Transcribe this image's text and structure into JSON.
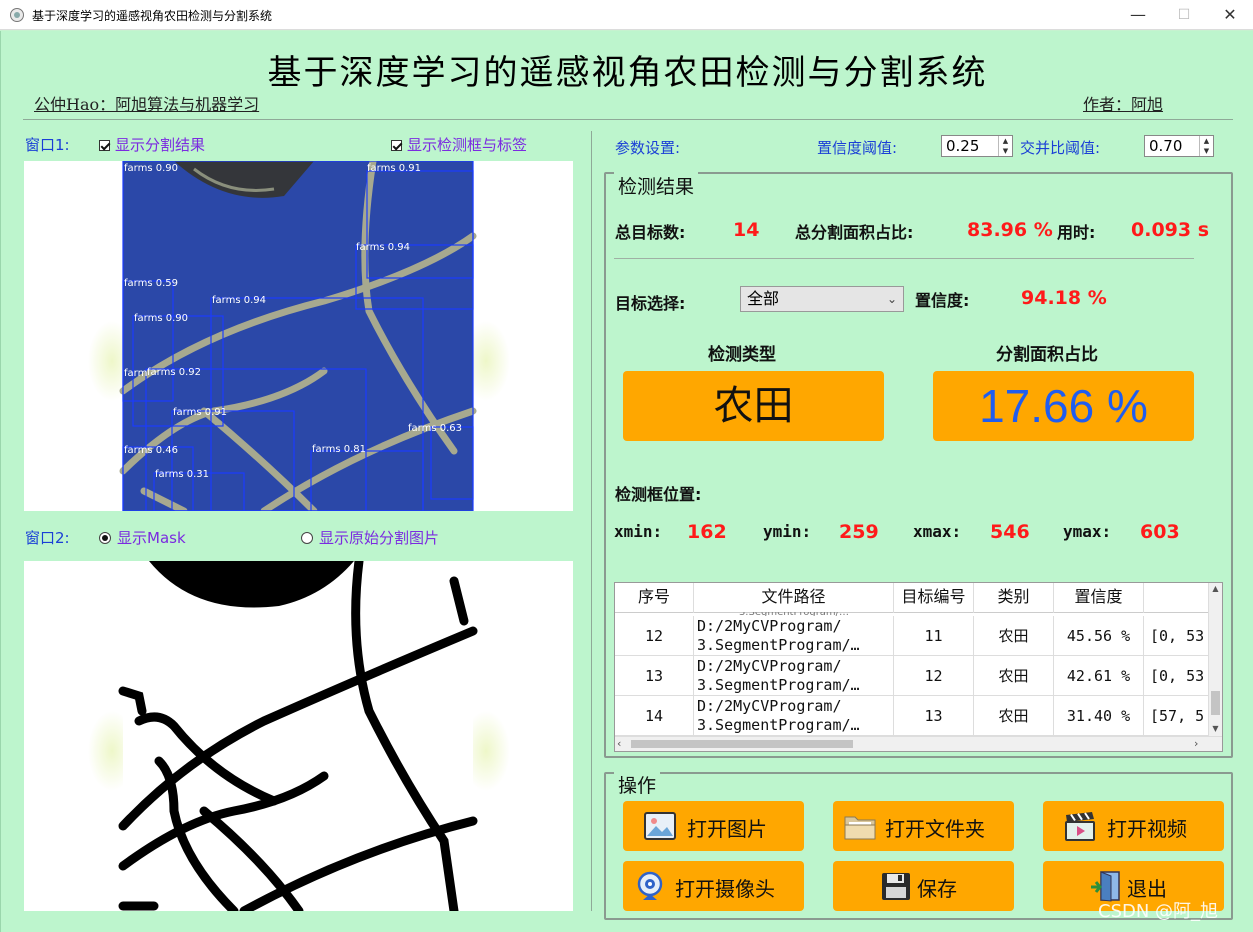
{
  "window": {
    "title": "基于深度学习的遥感视角农田检测与分割系统",
    "min": "—",
    "max": "☐",
    "close": "✕"
  },
  "header": {
    "title": "基于深度学习的遥感视角农田检测与分割系统",
    "left_caption": "公仲Hao：阿旭算法与机器学习",
    "right_caption": "作者：阿旭"
  },
  "window1": {
    "label": "窗口1:",
    "show_seg": "显示分割结果",
    "show_seg_checked": true,
    "show_box": "显示检测框与标签",
    "show_box_checked": true,
    "detections": [
      {
        "label": "farms 0.90"
      },
      {
        "label": "farms 0.91"
      },
      {
        "label": "farms 0.94"
      },
      {
        "label": "farms 0.59"
      },
      {
        "label": "farms 0.94"
      },
      {
        "label": "farms 0.90"
      },
      {
        "label": "farms 0.92"
      },
      {
        "label": "farms 0.91"
      },
      {
        "label": "farms 0.63"
      },
      {
        "label": "farms 0.46"
      },
      {
        "label": "farms 0.81"
      },
      {
        "label": "farms 0.31"
      },
      {
        "label": "farm"
      }
    ]
  },
  "window2": {
    "label": "窗口2:",
    "show_mask": "显示Mask",
    "show_mask_selected": true,
    "show_orig": "显示原始分割图片",
    "show_orig_selected": false
  },
  "params": {
    "label": "参数设置:",
    "conf_label": "置信度阈值:",
    "conf_value": "0.25",
    "iou_label": "交并比阈值:",
    "iou_value": "0.70"
  },
  "results": {
    "group_title": "检测结果",
    "total_label": "总目标数:",
    "total_value": "14",
    "seg_ratio_label": "总分割面积占比:",
    "seg_ratio_value": "83.96 %",
    "time_label": "用时:",
    "time_value": "0.093 s",
    "target_label": "目标选择:",
    "target_value": "全部",
    "conf_label": "置信度:",
    "conf_value": "94.18 %",
    "type_label": "检测类型",
    "type_value": "农田",
    "area_label": "分割面积占比",
    "area_value": "17.66 %",
    "box_label": "检测框位置:",
    "xmin_label": "xmin:",
    "xmin": "162",
    "ymin_label": "ymin:",
    "ymin": "259",
    "xmax_label": "xmax:",
    "xmax": "546",
    "ymax_label": "ymax:",
    "ymax": "603"
  },
  "table": {
    "headers": [
      "序号",
      "文件路径",
      "目标编号",
      "类别",
      "置信度",
      ""
    ],
    "rows": [
      {
        "idx": "12",
        "path1": "D:/2MyCVProgram/",
        "path2": "3.SegmentProgram/…",
        "target": "11",
        "cls": "农田",
        "conf": "45.56 %",
        "box": "[0, 53"
      },
      {
        "idx": "13",
        "path1": "D:/2MyCVProgram/",
        "path2": "3.SegmentProgram/…",
        "target": "12",
        "cls": "农田",
        "conf": "42.61 %",
        "box": "[0, 53"
      },
      {
        "idx": "14",
        "path1": "D:/2MyCVProgram/",
        "path2": "3.SegmentProgram/…",
        "target": "13",
        "cls": "农田",
        "conf": "31.40 %",
        "box": "[57, 5"
      }
    ]
  },
  "ops": {
    "group_title": "操作",
    "open_image": "打开图片",
    "open_folder": "打开文件夹",
    "open_video": "打开视频",
    "open_camera": "打开摄像头",
    "save": "保存",
    "exit": "退出"
  },
  "watermark": "CSDN @阿_旭",
  "colors": {
    "background": "#bdf5cd",
    "accent_orange": "#ffa700",
    "value_red": "#ff1a1a",
    "label_blue": "#1a3fd6",
    "area_blue": "#1f5df0"
  }
}
